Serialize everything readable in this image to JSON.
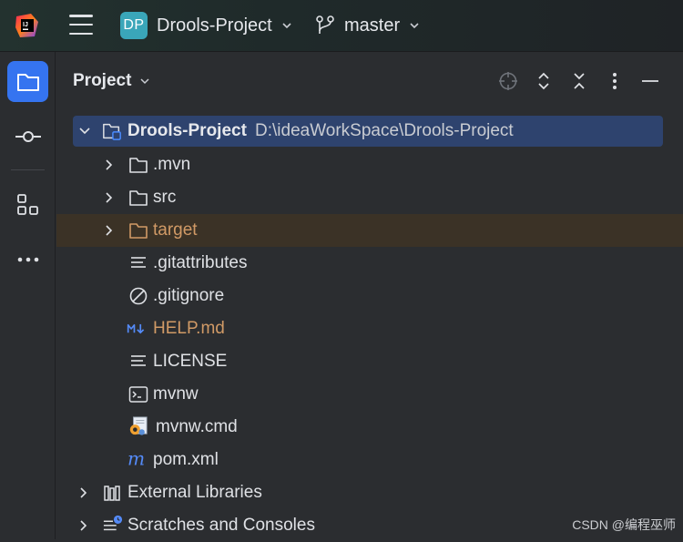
{
  "topbar": {
    "project_badge": "DP",
    "project_name": "Drools-Project",
    "branch_name": "master"
  },
  "panel": {
    "title": "Project"
  },
  "tree": {
    "root": {
      "name": "Drools-Project",
      "path": "D:\\ideaWorkSpace\\Drools-Project"
    },
    "items": [
      {
        "name": ".mvn"
      },
      {
        "name": "src"
      },
      {
        "name": "target"
      },
      {
        "name": ".gitattributes"
      },
      {
        "name": ".gitignore"
      },
      {
        "name": "HELP.md"
      },
      {
        "name": "LICENSE"
      },
      {
        "name": "mvnw"
      },
      {
        "name": "mvnw.cmd"
      },
      {
        "name": "pom.xml"
      }
    ],
    "external_libraries": "External Libraries",
    "scratches": "Scratches and Consoles"
  },
  "watermark": "CSDN @编程巫师",
  "colors": {
    "accent": "#3574f0",
    "selection": "#2e436e",
    "excluded_folder": "#d19a66",
    "badge": "#3aa6b9"
  }
}
